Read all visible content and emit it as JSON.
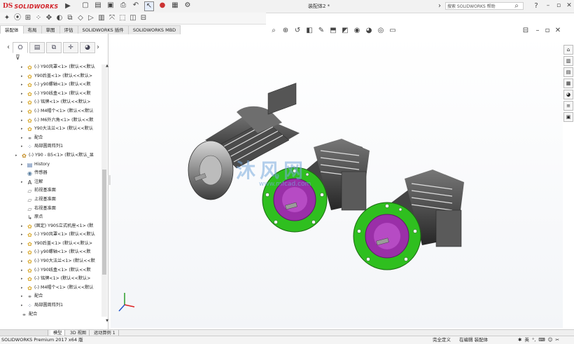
{
  "app": {
    "logo_ds": "DS",
    "logo_text": "SOLIDWORKS",
    "document_title": "装配体2 *",
    "search_placeholder": "搜索 SOLIDWORKS 帮助"
  },
  "title_icons": [
    "new-icon",
    "open-icon",
    "save-icon",
    "print-icon",
    "undo-icon",
    "select-icon",
    "rebuild-icon",
    "options-icon",
    "gear-icon"
  ],
  "toolbar2_icons": [
    "insert-component-icon",
    "mate-icon",
    "smart-fastener-icon",
    "pattern-icon",
    "move-component-icon",
    "show-hidden-icon",
    "assembly-feature-icon",
    "reference-geometry-icon",
    "new-motion-study-icon",
    "bom-icon",
    "exploded-view-icon",
    "instant3d-icon",
    "snapshot-icon",
    "large-assembly-icon"
  ],
  "tabs": [
    {
      "label": "装配体",
      "active": true
    },
    {
      "label": "布局",
      "active": false
    },
    {
      "label": "草图",
      "active": false
    },
    {
      "label": "评估",
      "active": false
    },
    {
      "label": "SOLIDWORKS 插件",
      "active": false
    },
    {
      "label": "SOLIDWORKS MBD",
      "active": false
    }
  ],
  "panel_tabs": [
    "feature-manager-icon",
    "property-manager-icon",
    "configuration-manager-icon",
    "dimxpert-icon",
    "display-manager-icon"
  ],
  "tree": [
    {
      "indent": 1,
      "arrow": true,
      "icon": "part",
      "label": "(-) Y90风罩<1> (默认<<默认"
    },
    {
      "indent": 1,
      "arrow": true,
      "icon": "part",
      "label": "Y90后盖<1> (默认<<默认>"
    },
    {
      "indent": 1,
      "arrow": true,
      "icon": "part",
      "label": "(-) y90螺轴<1> (默认<<默"
    },
    {
      "indent": 1,
      "arrow": true,
      "icon": "part",
      "label": "(-) Y90线盒<1> (默认<<默"
    },
    {
      "indent": 1,
      "arrow": true,
      "icon": "part",
      "label": "(-) 铭牌<1> (默认<<默认>"
    },
    {
      "indent": 1,
      "arrow": true,
      "icon": "part",
      "label": "(-) M4帽个<1> (默认<<默认"
    },
    {
      "indent": 1,
      "arrow": true,
      "icon": "part",
      "label": "(-) M6外六角<1> (默认<<默"
    },
    {
      "indent": 1,
      "arrow": true,
      "icon": "part",
      "label": "Y90大法兰<1> (默认<<默认"
    },
    {
      "indent": 1,
      "arrow": true,
      "icon": "mate",
      "label": "配合"
    },
    {
      "indent": 1,
      "arrow": true,
      "icon": "pattern",
      "label": "局部圆周阵列1"
    },
    {
      "indent": 0,
      "arrow": true,
      "icon": "assembly",
      "label": "(-) Y90 - B5<1> (默认<默认_显"
    },
    {
      "indent": 1,
      "arrow": true,
      "icon": "history",
      "label": "History"
    },
    {
      "indent": 1,
      "arrow": false,
      "icon": "sensor",
      "label": "传感器"
    },
    {
      "indent": 1,
      "arrow": true,
      "icon": "annotation",
      "label": "注解"
    },
    {
      "indent": 1,
      "arrow": false,
      "icon": "plane",
      "label": "前视基准面"
    },
    {
      "indent": 1,
      "arrow": false,
      "icon": "plane",
      "label": "上视基准面"
    },
    {
      "indent": 1,
      "arrow": false,
      "icon": "plane",
      "label": "右视基准面"
    },
    {
      "indent": 1,
      "arrow": false,
      "icon": "origin",
      "label": "原点"
    },
    {
      "indent": 1,
      "arrow": true,
      "icon": "part",
      "label": "(固定) Y90S立式机座<1> (默"
    },
    {
      "indent": 1,
      "arrow": true,
      "icon": "part",
      "label": "(-) Y90风罩<1> (默认<<默认"
    },
    {
      "indent": 1,
      "arrow": true,
      "icon": "part",
      "label": "Y90后盖<1> (默认<<默认>"
    },
    {
      "indent": 1,
      "arrow": true,
      "icon": "part",
      "label": "(-) y90螺轴<1> (默认<<默"
    },
    {
      "indent": 1,
      "arrow": true,
      "icon": "part",
      "label": "(-) Y90大法兰<1> (默认<<默"
    },
    {
      "indent": 1,
      "arrow": true,
      "icon": "part",
      "label": "(-) Y90线盒<1> (默认<<默"
    },
    {
      "indent": 1,
      "arrow": true,
      "icon": "part",
      "label": "(-) 铭牌<1> (默认<<默认>"
    },
    {
      "indent": 1,
      "arrow": true,
      "icon": "part",
      "label": "(-) M4帽个<1> (默认<<默认"
    },
    {
      "indent": 1,
      "arrow": true,
      "icon": "mate",
      "label": "配合"
    },
    {
      "indent": 1,
      "arrow": true,
      "icon": "pattern",
      "label": "局部圆周阵列1"
    },
    {
      "indent": 0,
      "arrow": false,
      "icon": "mate",
      "label": "配合"
    }
  ],
  "watermark": {
    "text": "沐风网",
    "url": "www.mfcad.com"
  },
  "bottom_tabs": [
    "模型",
    "3D 视图",
    "运动算例 1"
  ],
  "status": {
    "product": "SOLIDWORKS Premium 2017 x64 版",
    "definition": "完全定义",
    "editing": "在编辑 装配体"
  },
  "colors": {
    "flange_green": "#2fbf1f",
    "rotor_magenta": "#9a2fa8",
    "housing_grey": "#8a8a8a",
    "dark_grey": "#3a3a3a",
    "accent_red": "#d2232a",
    "icon_yellow": "#e8c33a"
  }
}
